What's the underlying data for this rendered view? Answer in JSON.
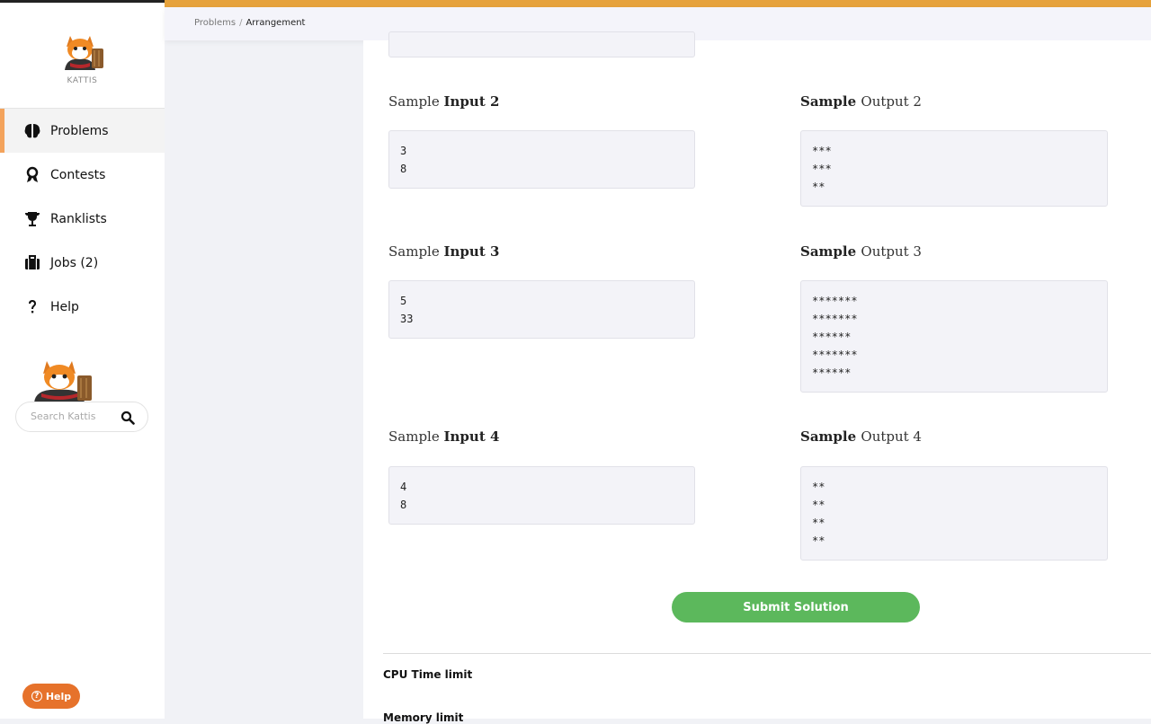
{
  "brand": {
    "name": "KATTIS"
  },
  "nav": {
    "items": [
      {
        "label": "Problems",
        "icon": "brain-icon",
        "active": true
      },
      {
        "label": "Contests",
        "icon": "award-icon",
        "active": false
      },
      {
        "label": "Ranklists",
        "icon": "trophy-icon",
        "active": false
      },
      {
        "label": "Jobs (2)",
        "icon": "briefcase-icon",
        "active": false
      },
      {
        "label": "Help",
        "icon": "question-icon",
        "active": false
      }
    ]
  },
  "search": {
    "placeholder": "Search Kattis"
  },
  "help_button": {
    "label": "Help"
  },
  "breadcrumb": {
    "root": "Problems",
    "separator": "/",
    "current": "Arrangement"
  },
  "samples": [
    {
      "input_head_a": "Sample ",
      "input_head_b": "Input 2",
      "output_head_a": "Sample ",
      "output_head_b": "Output 2",
      "input": "3\n8",
      "output": "***\n***\n**"
    },
    {
      "input_head_a": "Sample ",
      "input_head_b": "Input 3",
      "output_head_a": "Sample ",
      "output_head_b": "Output 3",
      "input": "5\n33",
      "output": "*******\n*******\n******\n*******\n******"
    },
    {
      "input_head_a": "Sample ",
      "input_head_b": "Input 4",
      "output_head_a": "Sample ",
      "output_head_b": "Output 4",
      "input": "4\n8",
      "output": "**\n**\n**\n**"
    }
  ],
  "submit": {
    "label": "Submit Solution"
  },
  "limits": {
    "cpu": "CPU Time limit",
    "memory": "Memory limit"
  },
  "colors": {
    "accent": "#e6a23c",
    "active_marker": "#f3a35c",
    "submit": "#5cb85c",
    "help": "#e6722b"
  }
}
